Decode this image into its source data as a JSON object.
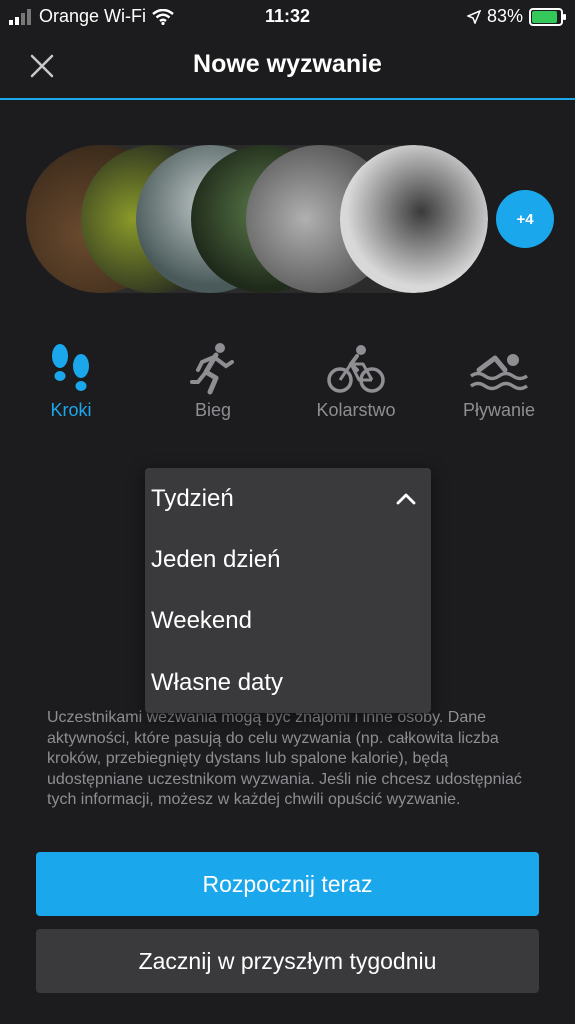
{
  "status": {
    "carrier": "Orange Wi-Fi",
    "time": "11:32",
    "battery": "83%",
    "battery_level": 0.83
  },
  "nav": {
    "title": "Nowe wyzwanie",
    "close_icon": "close-icon"
  },
  "participants": {
    "more_badge": "+4"
  },
  "activities": [
    {
      "label": "Kroki",
      "icon": "footprints-icon",
      "active": true
    },
    {
      "label": "Bieg",
      "icon": "runner-icon",
      "active": false
    },
    {
      "label": "Kolarstwo",
      "icon": "bicycle-icon",
      "active": false
    },
    {
      "label": "Pływanie",
      "icon": "swimmer-icon",
      "active": false
    }
  ],
  "duration_dropdown": {
    "selected": "Tydzień",
    "options": [
      "Jeden dzień",
      "Weekend",
      "Własne daty"
    ]
  },
  "info": {
    "text": "Uczestnikami wezwania mogą być znajomi i inne osoby. Dane aktywności, które pasują do celu wyzwania (np. całkowita liczba kroków, przebiegnięty dystans lub spalone kalorie), będą udostępniane uczestnikom wyzwania. Jeśli nie chcesz udostępniać tych informacji, możesz w każdej chwili opuścić wyzwanie."
  },
  "buttons": {
    "start_now": "Rozpocznij teraz",
    "start_next_week": "Zacznij w przyszłym tygodniu"
  },
  "colors": {
    "accent": "#1aa7ec",
    "background": "#1c1c1e",
    "secondary_button": "#3a3a3c",
    "muted_text": "#8e8e93",
    "battery": "#34c759"
  }
}
